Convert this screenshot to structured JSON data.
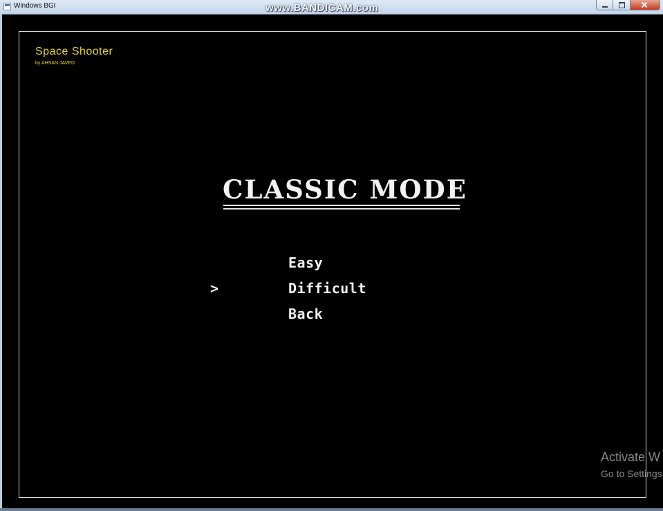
{
  "window": {
    "title": "Windows BGI",
    "watermark": "www.BANDICAM.com"
  },
  "game": {
    "title": "Space Shooter",
    "author": "by AHSAN JAVED",
    "title_color": "#e8d51e"
  },
  "menu": {
    "heading": "CLASSIC MODE",
    "cursor": ">",
    "selected": "Difficult",
    "items": [
      {
        "label": "Easy"
      },
      {
        "label": "Difficult"
      },
      {
        "label": "Back"
      }
    ]
  },
  "os_overlay": {
    "title": "Activate W",
    "subtitle": "Go to Settings"
  }
}
